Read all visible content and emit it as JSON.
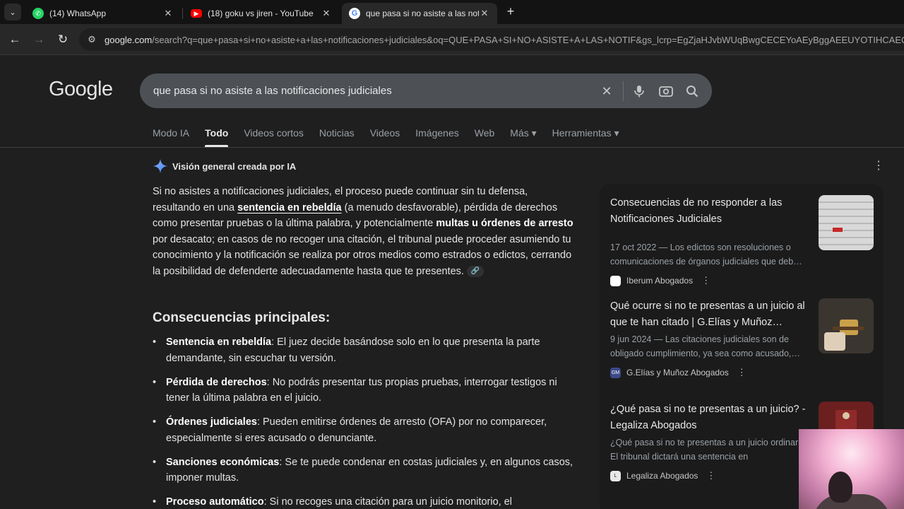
{
  "browser": {
    "tabs": [
      {
        "title": "(14) WhatsApp",
        "favicon": "whatsapp-icon",
        "color": "#25d366"
      },
      {
        "title": "(18) goku vs jiren - YouTube",
        "favicon": "youtube-icon",
        "color": "#ff0000"
      },
      {
        "title": "que pasa si no asiste a las notifi",
        "favicon": "google-icon",
        "color": "#ffffff"
      }
    ],
    "url_host": "google.com",
    "url_path": "/search?q=que+pasa+si+no+asiste+a+las+notificaciones+judiciales&oq=QUE+PASA+SI+NO+ASISTE+A+LAS+NOTIF&gs_lcrp=EgZjaHJvbWUqBwgCECEYoAEyBggAEEUYOTIHCAEQIR"
  },
  "google": {
    "logo": "Google",
    "query": "que pasa si no asiste a las notificaciones judiciales",
    "tabs": [
      "Modo IA",
      "Todo",
      "Videos cortos",
      "Noticias",
      "Videos",
      "Imágenes",
      "Web",
      "Más ▾"
    ],
    "active_tab": "Todo",
    "tools": "Herramientas ▾"
  },
  "ai_overview": {
    "heading": "Visión general creada por IA",
    "p1": "Si no asistes a notificaciones judiciales, el proceso puede continuar sin tu defensa, resultando en una ",
    "b1": "sentencia en rebeldía",
    "p2": " (a menudo desfavorable), pérdida de derechos como presentar pruebas o la última palabra, y potencialmente ",
    "b2": "multas u órdenes de arresto",
    "p3": " por desacato; en casos de no recoger una citación, el tribunal puede proceder asumiendo tu conocimiento y la notificación se realiza por otros medios como estrados o edictos, cerrando la posibilidad de defenderte adecuadamente hasta que te presentes.",
    "subheading": "Consecuencias principales:",
    "bullets": [
      {
        "term": "Sentencia en rebeldía",
        "text": ": El juez decide basándose solo en lo que presenta la parte demandante, sin escuchar tu versión."
      },
      {
        "term": "Pérdida de derechos",
        "text": ": No podrás presentar tus propias pruebas, interrogar testigos ni tener la última palabra en el juicio."
      },
      {
        "term": "Órdenes judiciales",
        "text": ": Pueden emitirse órdenes de arresto (OFA) por no comparecer, especialmente si eres acusado o denunciante."
      },
      {
        "term": "Sanciones económicas",
        "text": ": Se te puede condenar en costas judiciales y, en algunos casos, imponer multas."
      },
      {
        "term": "Proceso automático",
        "text": ": Si no recoges una citación para un juicio monitorio, el"
      }
    ]
  },
  "sources": [
    {
      "title": "Consecuencias de no responder a las Notificaciones Judiciales",
      "desc": "17 oct 2022 — Los edictos son resoluciones o comunicaciones de órganos judiciales que deb…",
      "site": "Iberum Abogados"
    },
    {
      "title": "Qué ocurre si no te presentas a un juicio al que te han citado | G.Elías y Muñoz…",
      "desc": "9 jun 2024 — Las citaciones judiciales son de obligado cumplimiento, ya sea como acusado,…",
      "site": "G.Elías y Muñoz Abogados"
    },
    {
      "title": "¿Qué pasa si no te presentas a un juicio? - Legaliza Abogados",
      "desc": "¿Qué pasa si no te presentas a un juicio ordinario? El tribunal dictará una sentencia en",
      "site": "Legaliza Abogados"
    }
  ]
}
